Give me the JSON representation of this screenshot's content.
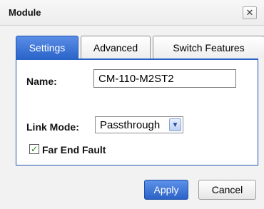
{
  "window": {
    "title": "Module",
    "close_glyph": "✕",
    "close_icon": "close-icon"
  },
  "tabs": [
    {
      "label": "Settings",
      "active": true
    },
    {
      "label": "Advanced",
      "active": false
    },
    {
      "label": "Switch Features",
      "active": false
    }
  ],
  "form": {
    "name_label": "Name:",
    "name_value": "CM-110-M2ST2",
    "link_mode_label": "Link Mode:",
    "link_mode_value": "Passthrough",
    "link_mode_arrow": "▼",
    "far_end_fault_label": "Far End Fault",
    "far_end_fault_checked": true,
    "check_glyph": "✓"
  },
  "buttons": {
    "apply": "Apply",
    "cancel": "Cancel"
  },
  "colors": {
    "accent": "#2a64c8",
    "dialog_bg": "#f2f2f2",
    "panel_bg": "#ffffff"
  }
}
